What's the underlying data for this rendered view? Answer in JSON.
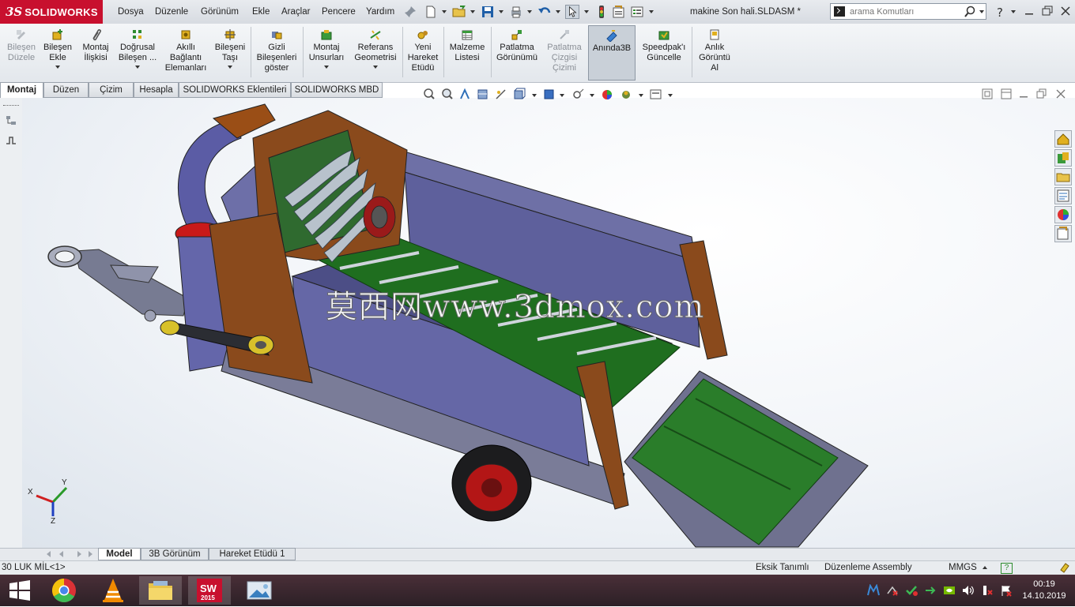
{
  "app": {
    "brand_prefix": "3S",
    "brand_name": "SOLIDWORKS",
    "document_title": "makine Son hali.SLDASM *"
  },
  "menu": [
    "Dosya",
    "Düzenle",
    "Görünüm",
    "Ekle",
    "Araçlar",
    "Pencere",
    "Yardım"
  ],
  "search": {
    "placeholder": "arama Komutları"
  },
  "commands": [
    {
      "label": "Bileşen\nDüzele",
      "disabled": true
    },
    {
      "label": "Bileşen\nEkle"
    },
    {
      "label": "Montaj\nİlişkisi"
    },
    {
      "label": "Doğrusal\nBileşen ..."
    },
    {
      "label": "Akıllı\nBağlantı\nElemanları"
    },
    {
      "label": "Bileşeni\nTaşı"
    },
    {
      "label": "Gizli\nBileşenleri\ngöster"
    },
    {
      "label": "Montaj\nUnsurları"
    },
    {
      "label": "Referans\nGeometrisi"
    },
    {
      "label": "Yeni\nHareket\nEtüdü"
    },
    {
      "label": "Malzeme\nListesi"
    },
    {
      "label": "Patlatma\nGörünümü"
    },
    {
      "label": "Patlatma\nÇizgisi\nÇizimi",
      "disabled": true
    },
    {
      "label": "Anında3B",
      "active": true
    },
    {
      "label": "Speedpak'ı\nGüncelle"
    },
    {
      "label": "Anlık\nGörüntü\nAl"
    }
  ],
  "tabs": [
    "Montaj",
    "Düzen",
    "Çizim",
    "Hesapla",
    "SOLIDWORKS Eklentileri",
    "SOLIDWORKS MBD"
  ],
  "viewport": {
    "watermark": "莫西网www.3dmox.com",
    "triad": {
      "x": "X",
      "y": "Y",
      "z": "Z"
    }
  },
  "bottom_tabs": [
    "Model",
    "3B Görünüm",
    "Hareket Etüdü 1"
  ],
  "status": {
    "left": "30 LUK MİL<1>",
    "defined": "Eksik Tanımlı",
    "mode": "Düzenleme Assembly",
    "units": "MMGS",
    "help": "?"
  },
  "clock": {
    "time": "00:19",
    "date": "14.10.2019"
  },
  "colors": {
    "brand_red": "#c8102e",
    "assembly_purple": "#6b6ca8",
    "assembly_brown": "#8a4a1c",
    "assembly_green": "#1e6b1e"
  }
}
